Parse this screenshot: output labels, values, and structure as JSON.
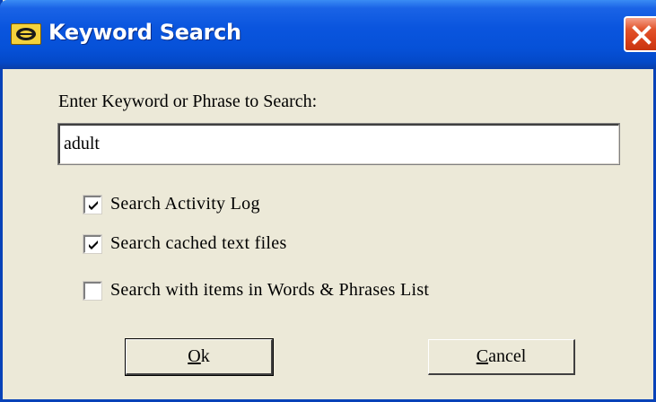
{
  "window": {
    "title": "Keyword Search",
    "titlebar_color": "#0A55DE",
    "close_color": "#D8401A"
  },
  "prompt": {
    "label": "Enter Keyword or Phrase to Search:"
  },
  "keyword_input": {
    "value": "adult"
  },
  "options": [
    {
      "label": "Search Activity Log",
      "checked": true
    },
    {
      "label": "Search cached text files",
      "checked": true
    },
    {
      "label": "Search with items in Words & Phrases List",
      "checked": false
    }
  ],
  "buttons": {
    "ok": {
      "mnemonic": "O",
      "rest": "k"
    },
    "cancel": {
      "mnemonic": "C",
      "rest": "ancel"
    }
  }
}
